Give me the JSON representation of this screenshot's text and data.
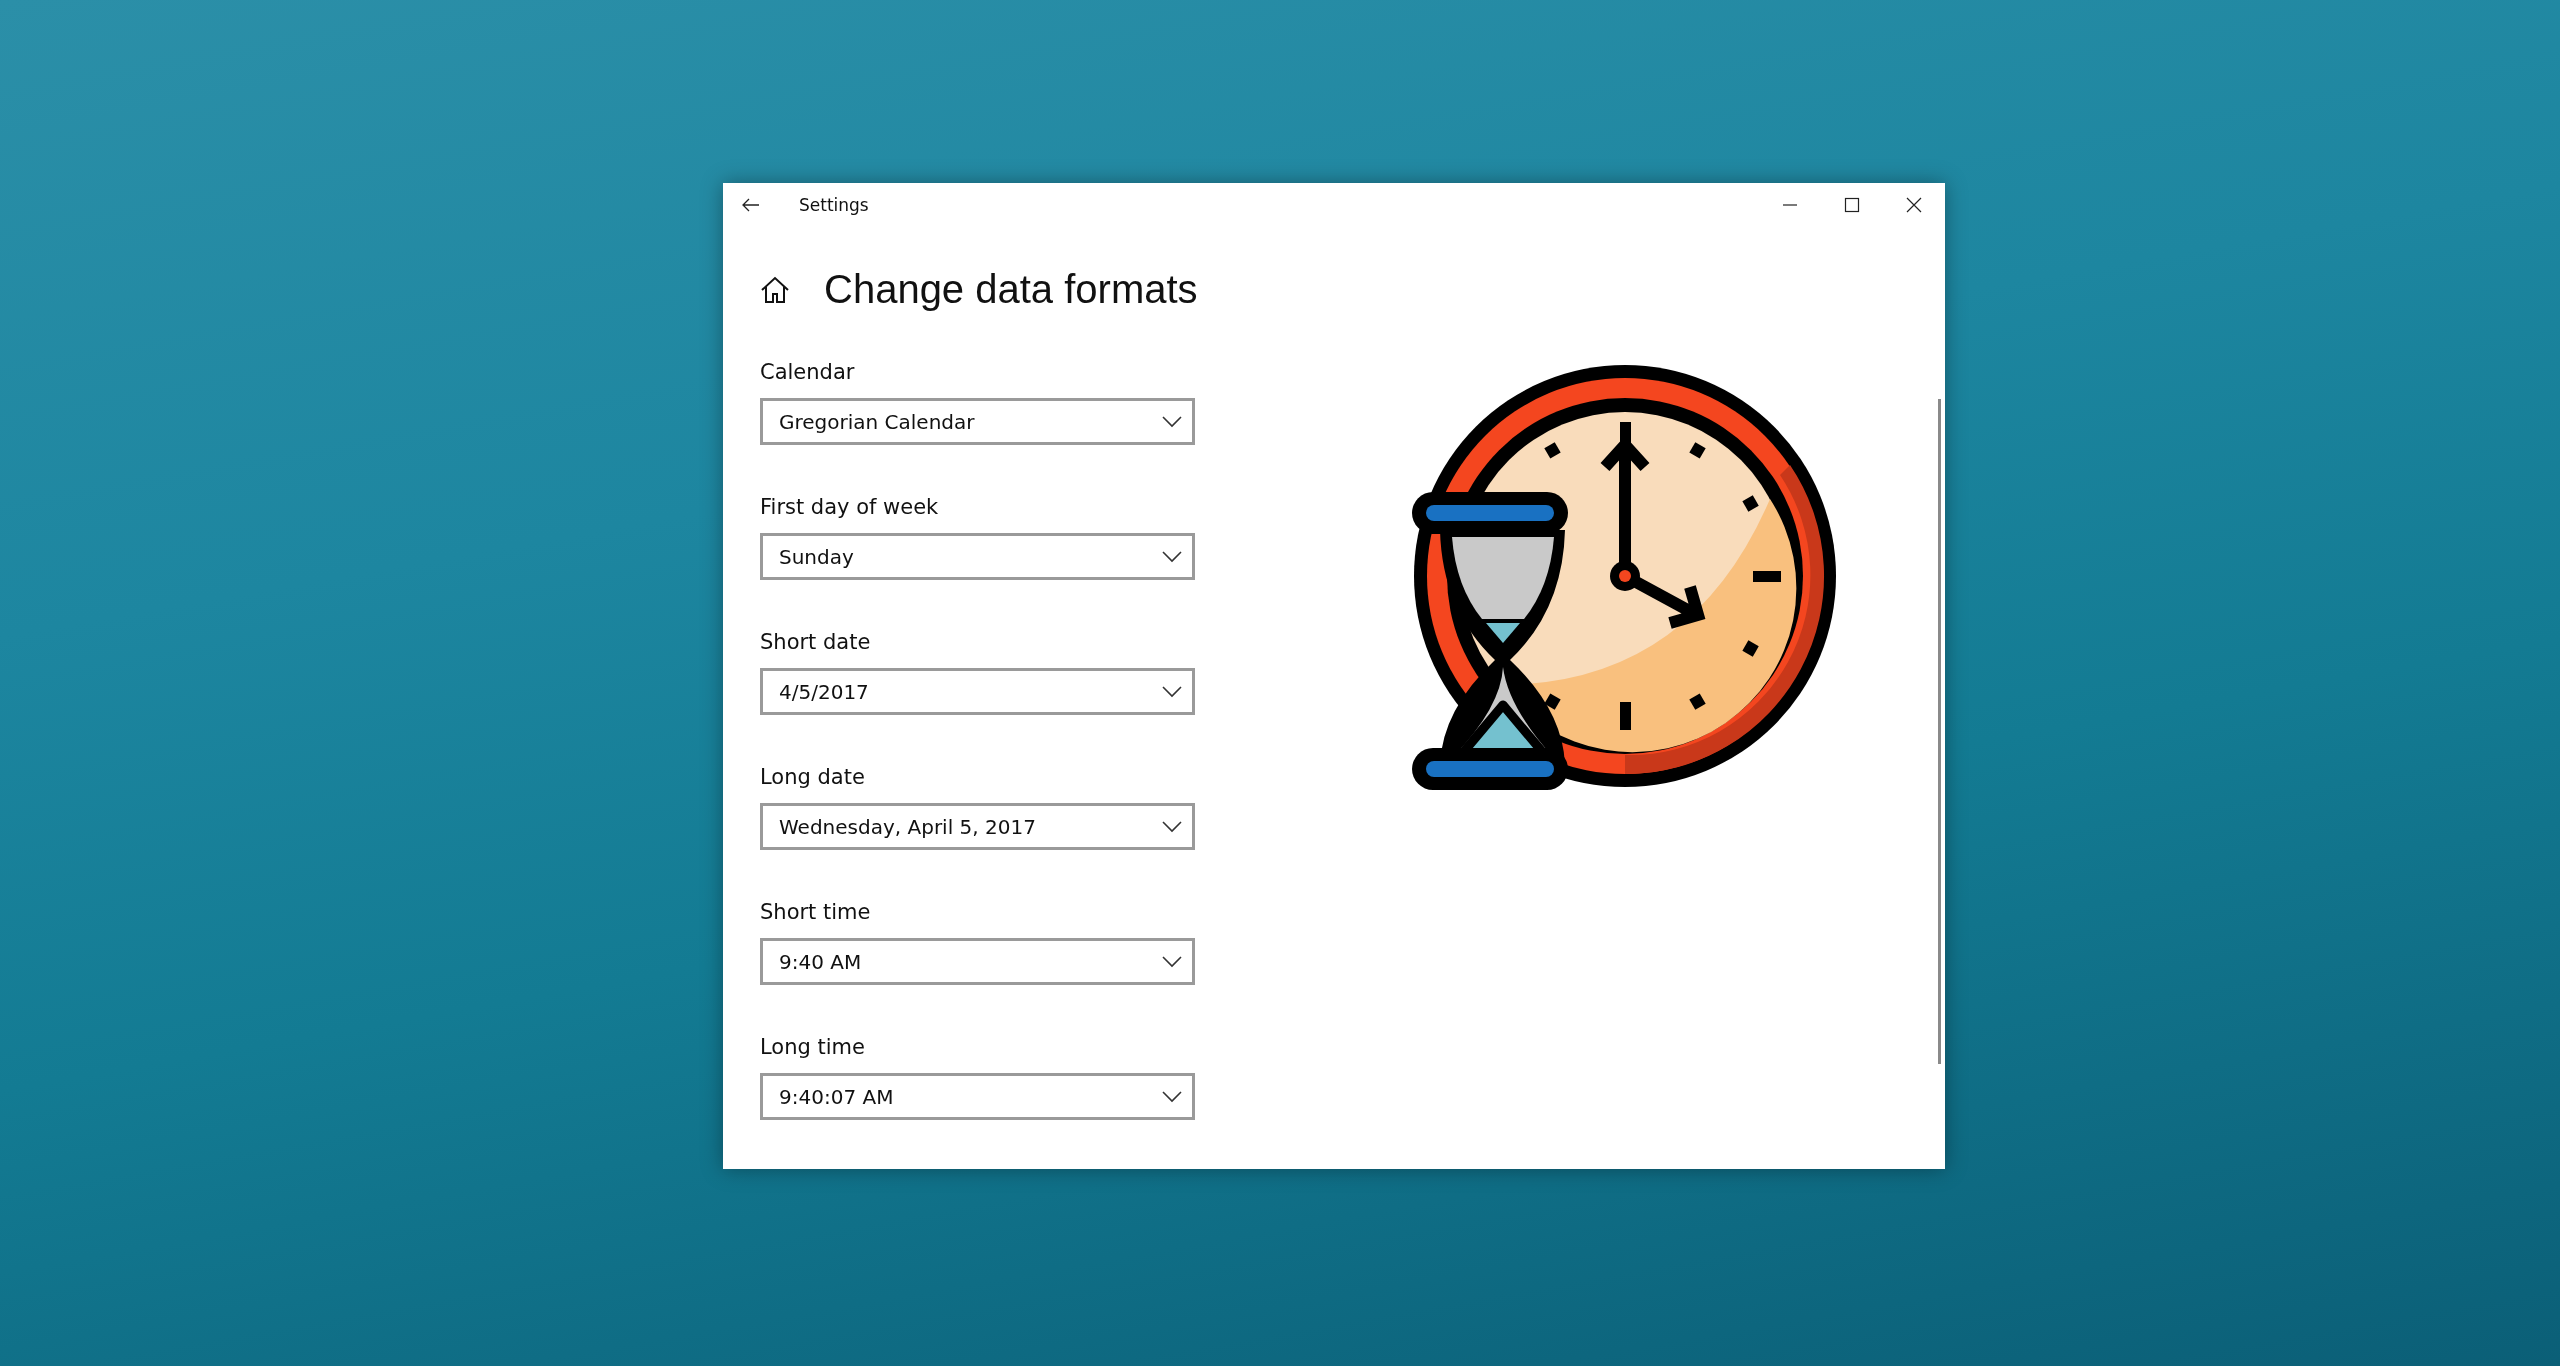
{
  "window": {
    "title": "Settings"
  },
  "page": {
    "title": "Change data formats"
  },
  "settings": [
    {
      "label": "Calendar",
      "value": "Gregorian Calendar"
    },
    {
      "label": "First day of week",
      "value": "Sunday"
    },
    {
      "label": "Short date",
      "value": "4/5/2017"
    },
    {
      "label": "Long date",
      "value": "Wednesday, April 5, 2017"
    },
    {
      "label": "Short time",
      "value": "9:40 AM"
    },
    {
      "label": "Long time",
      "value": "9:40:07 AM"
    }
  ]
}
